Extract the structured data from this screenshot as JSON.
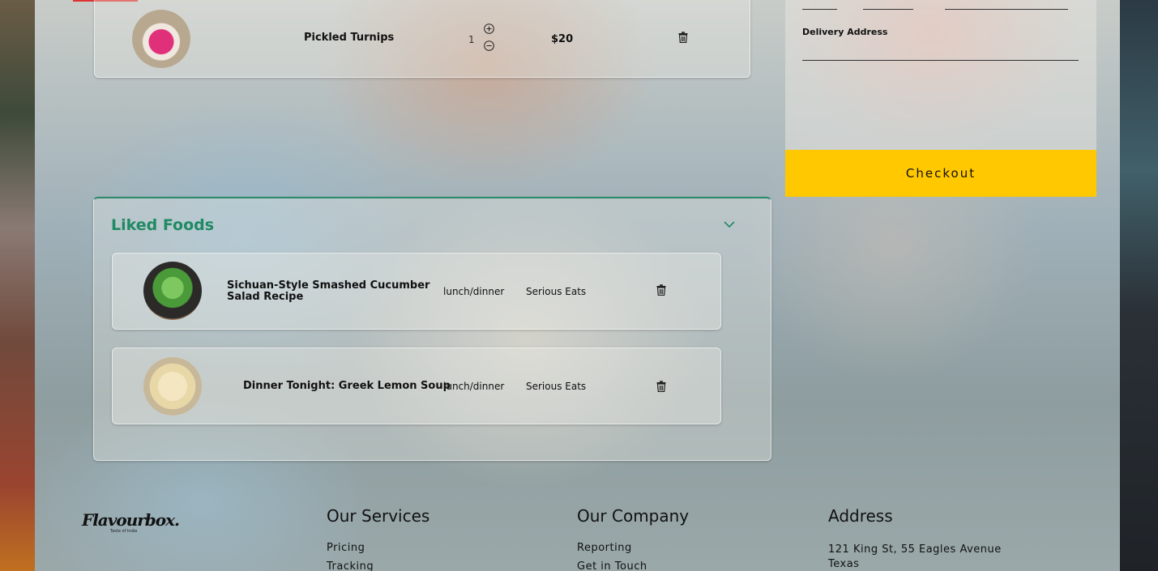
{
  "cart": {
    "item": {
      "name": "Pickled Turnips",
      "quantity": "1",
      "price": "$20"
    }
  },
  "delivery": {
    "address_label": "Delivery Address",
    "address_value": ""
  },
  "checkout_label": "Checkout",
  "liked": {
    "title": "Liked Foods",
    "items": [
      {
        "name": "Sichuan-Style Smashed Cucumber Salad Recipe",
        "meal": "lunch/dinner",
        "source": "Serious Eats"
      },
      {
        "name": "Dinner Tonight: Greek Lemon Soup",
        "meal": "lunch/dinner",
        "source": "Serious Eats"
      }
    ]
  },
  "footer": {
    "logo": "Flavourbox.",
    "tagline": "Taste of India",
    "services": {
      "title": "Our Services",
      "links": [
        "Pricing",
        "Tracking"
      ]
    },
    "company": {
      "title": "Our Company",
      "links": [
        "Reporting",
        "Get in Touch"
      ]
    },
    "address": {
      "title": "Address",
      "lines": [
        "121 King St, 55 Eagles Avenue",
        "Texas"
      ]
    }
  },
  "colors": {
    "accent": "#1f8a63",
    "checkout": "#ffc800"
  },
  "icons": [
    "plus-circle-icon",
    "minus-circle-icon",
    "trash-icon",
    "chevron-down-icon"
  ]
}
